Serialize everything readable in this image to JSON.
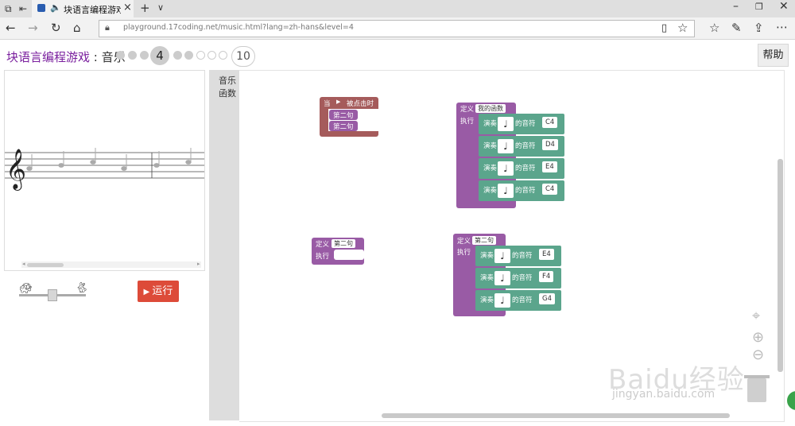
{
  "browser": {
    "tab_title": "块语言编程游戏：音",
    "url": "playground.17coding.net/music.html?lang=zh-hans&level=4"
  },
  "header": {
    "title_app": "块语言编程游戏",
    "title_sep": " : ",
    "title_level": "音乐",
    "current_level": "4",
    "last_level": "10",
    "help_label": "帮助"
  },
  "controls": {
    "run_label": "运行"
  },
  "toolbox": {
    "categories": [
      "音乐",
      "函数"
    ]
  },
  "blocks": {
    "event": {
      "when": "当",
      "clicked": "被点击时",
      "calls": [
        "第二句",
        "第二句"
      ]
    },
    "def_main": {
      "define": "定义",
      "name": "我的函数",
      "do": "执行",
      "plays": [
        {
          "play": "演奏",
          "of": "的音符",
          "note": "C4"
        },
        {
          "play": "演奏",
          "of": "的音符",
          "note": "D4"
        },
        {
          "play": "演奏",
          "of": "的音符",
          "note": "E4"
        },
        {
          "play": "演奏",
          "of": "的音符",
          "note": "C4"
        }
      ]
    },
    "def_empty": {
      "define": "定义",
      "name": "第二句",
      "do": "执行"
    },
    "def_second": {
      "define": "定义",
      "name": "第二句",
      "do": "执行",
      "plays": [
        {
          "play": "演奏",
          "of": "的音符",
          "note": "E4"
        },
        {
          "play": "演奏",
          "of": "的音符",
          "note": "F4"
        },
        {
          "play": "演奏",
          "of": "的音符",
          "note": "G4"
        }
      ]
    }
  },
  "watermark": {
    "brand": "Baidu经验",
    "site": "jingyan.baidu.com"
  },
  "colors": {
    "event_block": "#a55b5b",
    "procedure_block": "#995ba5",
    "play_block": "#5ba58c",
    "run_button": "#dd4b39",
    "title_accent": "#7a1f9e"
  },
  "icons": [
    "tab-manager-icon",
    "back-icon",
    "forward-icon",
    "refresh-icon",
    "home-icon",
    "lock-icon",
    "reading-view-icon",
    "favorite-star-icon",
    "favorites-icon",
    "pen-icon",
    "share-icon",
    "more-icon",
    "minimize-icon",
    "restore-icon",
    "close-icon",
    "tortoise-icon",
    "hare-icon",
    "play-icon",
    "treble-clef-icon",
    "center-icon",
    "zoom-in-icon",
    "zoom-out-icon",
    "trash-icon"
  ]
}
